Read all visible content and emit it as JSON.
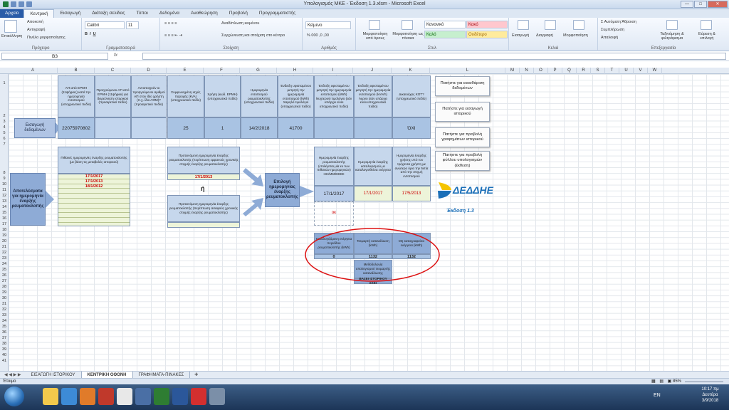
{
  "window": {
    "title": "Υπολογισμός ΜΚΕ - Έκδοση 1.3.xlsm - Microsoft Excel"
  },
  "ribbon_tabs": [
    "Αρχείο",
    "Κεντρική",
    "Εισαγωγή",
    "Διάταξη σελίδας",
    "Τύποι",
    "Δεδομένα",
    "Αναθεώρηση",
    "Προβολή",
    "Προγραμματιστής"
  ],
  "ribbon": {
    "clipboard": {
      "paste": "Επικόλληση",
      "cut": "Αποκοπή",
      "copy": "Αντιγραφή",
      "painter": "Πινέλο μορφοποίησης",
      "label": "Πρόχειρο"
    },
    "font": {
      "name": "Calibri",
      "size": "11",
      "label": "Γραμματοσειρά"
    },
    "alignment": {
      "wrap": "Αναδίπλωση κειμένου",
      "merge": "Συγχώνευση και στοίχιση στο κέντρο",
      "label": "Στοίχιση"
    },
    "number": {
      "format": "Κείμενο",
      "label": "Αριθμός"
    },
    "styles": {
      "conditional": "Μορφοποίηση υπό όρους",
      "table": "Μορφοποίηση ως πίνακα",
      "normal": "Κανονικό",
      "bad": "Κακό",
      "good": "Καλό",
      "neutral": "Ουδέτερο",
      "label": "Στυλ"
    },
    "cells": {
      "insert": "Εισαγωγή",
      "delete": "Διαγραφή",
      "format": "Μορφοποίηση",
      "label": "Κελιά"
    },
    "editing": {
      "autosum": "Αυτόματη Άθροιση",
      "fill": "Συμπλήρωση",
      "clear": "Απαλοιφή",
      "sort": "Ταξινόμηση & φιλτράρισμα",
      "find": "Εύρεση & επιλογή",
      "label": "Επεξεργασία"
    }
  },
  "formula_bar": {
    "name_box": "B3",
    "fx": "fx",
    "value": ""
  },
  "columns": [
    "A",
    "B",
    "C",
    "D",
    "E",
    "F",
    "G",
    "H",
    "I",
    "J",
    "K",
    "L",
    "M",
    "N",
    "O",
    "P",
    "Q",
    "R",
    "S",
    "T",
    "U",
    "V",
    "W"
  ],
  "rows": [
    "1",
    "2",
    "3",
    "4",
    "5",
    "6",
    "7",
    "8",
    "9",
    "10",
    "11",
    "12",
    "13",
    "14",
    "15",
    "16",
    "17",
    "18",
    "19",
    "20",
    "21",
    "22",
    "23",
    "24",
    "25",
    "26",
    "27",
    "28",
    "29",
    "30",
    "31",
    "32",
    "33",
    "34",
    "35",
    "36",
    "37",
    "38",
    "39",
    "40",
    "41"
  ],
  "header_row": [
    "ΑΠ από ΕΡΜΗ (11ψήφιος) κατά την ημερομηνία εντοπισμού (υποχρεωτικό πεδίο)",
    "Προηγούμενοι ΑΠ από ΕΡΜΗ (11ψήφιοι) για διερεύνηση ιστορικού (προαιρετικό πεδίο)",
    "Αντιστοιχούν οι προηγούμενοι αριθμοί ΑΠ στον ίδιο χρήστη (π.χ. ίδιο ΑΦΜ)? (προαιρετικό πεδίο)",
    "Συμφωνημένη ισχύς παροχής (kVA) (υποχρεωτικό πεδίο)",
    "Χρήση (κωδ. ΕΡΜΗ) (υποχρεωτικό πεδίο)",
    "Ημερομηνία εντοπισμού ρευματοκλοπής (υποχρεωτικό πεδίο)",
    "Ένδειξη υφισταμένου μετρητή την ημερομηνία εντοπισμού (kWh) Χαμηλό τιμολόγιο (υποχρεωτικό πεδίο)",
    "Ένδειξη υφισταμένου μετρητή την ημερομηνία εντοπισμού (kWh) Νυχτερινό τιμολόγιο (εάν υπάρχει είναι υποχρεωτικό πεδίο)",
    "Ένδειξη υφισταμένου μετρητή την ημερομηνία εντοπισμού (kVArh) Άεργο (εάν υπάρχει είναι υποχρεωτικό πεδίο)",
    "Δικαιούχος ΚΟΤ? (υποχρεωτικό πεδίο)"
  ],
  "input_label": "Εισαγωγή δεδομένων",
  "input_row": {
    "ap": "22075970802",
    "kva": "25",
    "usage": "1",
    "date": "14/2/2018",
    "reading": "41700",
    "kot": "ΌΧΙ"
  },
  "results_label": "Αποτελέσματα για ημερομηνία έναρξης ρευματοκλοπής",
  "possible_dates": {
    "header": "Πιθανές ημερομηνίες έναρξης ρευματοκλοπής (με βάση τις μεταβολές ιστορικού)",
    "dates": [
      "17/1/2017",
      "17/1/2013",
      "18/1/2012"
    ]
  },
  "proposed_recent": {
    "header": "Προτεινόμενη ημερομηνία έναρξης ρευματοκλοπής (περίπτωση εμφανούς χρονικής στιγμής έναρξης ρευματοκλοπής)",
    "value": "17/1/2013"
  },
  "or_label": "ή",
  "proposed_unclear": {
    "header": "Προτεινόμενη ημερομηνία έναρξης ρευματοκλοπής (περίπτωση ασαφούς χρονικής στιγμής έναρξης ρευματοκλοπής)",
    "value": ""
  },
  "select_label": "Επιλογή ημερομηνίας έναρξης ρευματοκλοπής",
  "selection": {
    "h1": "Ημερομηνία έναρξης ρευματοκλοπής (επιλέγεται μία εκ των πιθανών ημερομηνιών) ΗΗ/ΜΜ/ΕΕΕΕ",
    "h2": "Ημερομηνία έναρξης καταλογισμού με καταλογισθείσα ενέργεια",
    "h3": "Ημερομηνία έναρξης χρήσης υπό τον τρέχοντα χρήστη με ανώτερο όριο την 5ετία από την στιγμή εντοπισμού",
    "v1": "17/1/2017",
    "v2": "17/1/2017",
    "v3": "17/5/2013",
    "ok": "οκ"
  },
  "energy": {
    "h1": "Καταλογιζόμενη ενέργεια περιόδου ρευματοκλοπής (kWh)",
    "v1": "0",
    "h2": "Τεκμαρτή κατανάλωση (kWh)",
    "v2": "1132",
    "h3": "Μη καταγραφείσα ενέργεια (kWh)",
    "v3": "1132",
    "method_h": "Μεθοδολογία υπολογισμού τεκμαρτής κατανάλωσης",
    "method_v": "ΒΑΣΕΙ ΙΣΤΟΡΙΚΟΥ ΣΧΕΙ"
  },
  "side_buttons": [
    "Πατήστε για εκκαθάριση δεδομένων",
    "Πατήστε για εισαγωγή ιστορικού",
    "Πατήστε για προβολή γραφημάτων ιστορικού",
    "Πατήστε για προβολή φύλλου υπολογισμών (έκθεση)"
  ],
  "logo": {
    "name": "ΔΕΔΔΗΕ",
    "version": "Έκδοση 1.3"
  },
  "sheet_tabs": [
    "ΕΙΣΑΓΩΓΗ ΙΣΤΟΡΙΚΟΥ",
    "ΚΕΝΤΡΙΚΗ ΟΘΟΝΗ",
    "ΓΡΑΦΗΜΑΤΑ-ΠΙΝΑΚΕΣ"
  ],
  "status": {
    "ready": "Έτοιμο",
    "zoom": "85%"
  },
  "taskbar": {
    "lang": "EN",
    "time": "10:17 πμ",
    "day": "Δευτέρα",
    "date": "3/9/2018"
  },
  "colors": {
    "header": "#c6d7ec",
    "data": "#a9c3e3",
    "block": "#8eabd6",
    "green": "#edf4d9",
    "red": "#cc0000",
    "logo_blue": "#1b6fb8",
    "logo_yellow": "#f5c400"
  }
}
